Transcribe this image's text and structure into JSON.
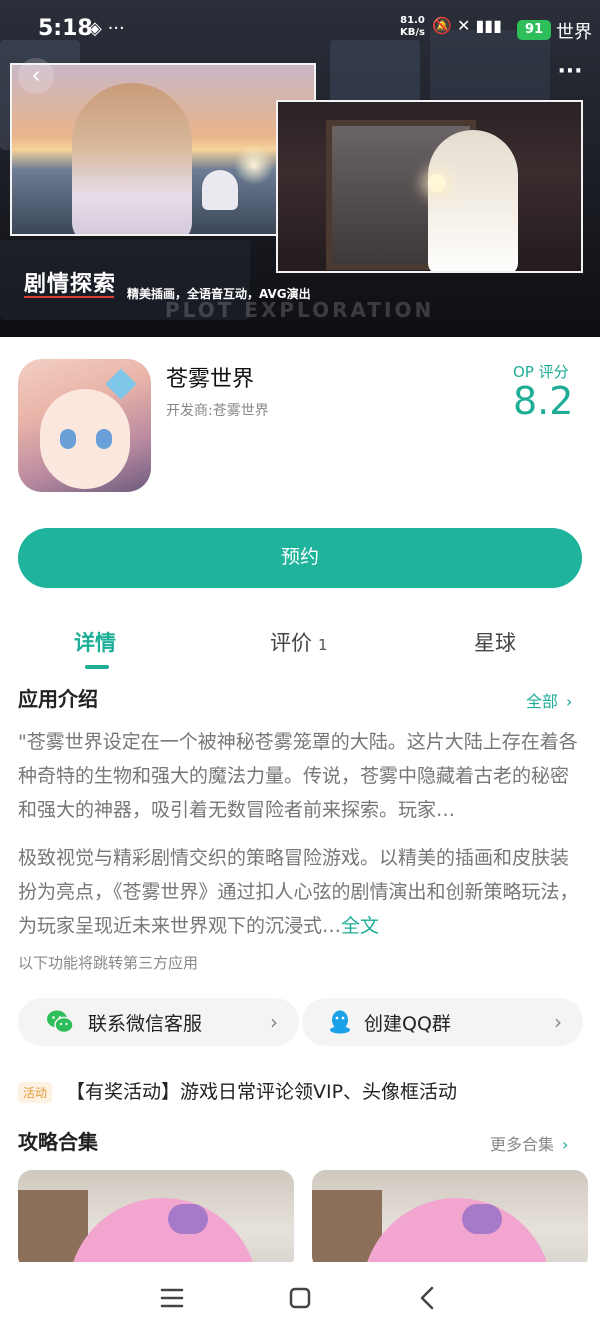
{
  "status_bar": {
    "time": "5:18",
    "extra_icons": "◈ ···",
    "net_speed_value": "81.0",
    "net_speed_unit": "KB/s",
    "right_icons": "🔕 ✕ ▮▮▮",
    "battery": "91",
    "brand": "世界"
  },
  "banner": {
    "title": "剧情探索",
    "subtitle": "精美插画，全语音互动，AVG演出",
    "watermark": "PLOT EXPLORATION",
    "back_icon": "chevron-left-icon",
    "more_icon": "more-dots-icon"
  },
  "app": {
    "name": "苍雾世界",
    "developer": "开发商:苍雾世界",
    "score_label": "OP 评分",
    "score_value": "8.2"
  },
  "primary_action": {
    "label": "预约"
  },
  "tabs": [
    {
      "label": "详情",
      "active": true
    },
    {
      "label": "评价",
      "count": "1",
      "active": false
    },
    {
      "label": "星球",
      "active": false
    }
  ],
  "intro": {
    "title": "应用介绍",
    "more_label": "全部",
    "paragraph1": "\"苍雾世界设定在一个被神秘苍雾笼罩的大陆。这片大陆上存在着各种奇特的生物和强大的魔法力量。传说，苍雾中隐藏着古老的秘密和强大的神器，吸引着无数冒险者前来探索。玩家…",
    "paragraph2": "极致视觉与精彩剧情交织的策略冒险游戏。以精美的插画和皮肤装扮为亮点，《苍雾世界》通过扣人心弦的剧情演出和创新策略玩法，为玩家呈现近未来世界观下的沉浸式…",
    "fulltext_label": "全文"
  },
  "third_party_note": "以下功能将跳转第三方应用",
  "services": [
    {
      "label": "联系微信客服",
      "icon": "wechat-icon"
    },
    {
      "label": "创建QQ群",
      "icon": "qq-icon"
    }
  ],
  "activity": {
    "tag": "活动",
    "text": "【有奖活动】游戏日常评论领VIP、头像框活动"
  },
  "guides": {
    "title": "攻略合集",
    "more_label": "更多合集"
  },
  "colors": {
    "accent": "#1fb39b",
    "activity_tag_text": "#e39a3a",
    "activity_tag_bg": "#fdf1e2",
    "battery": "#2fbf5a"
  }
}
